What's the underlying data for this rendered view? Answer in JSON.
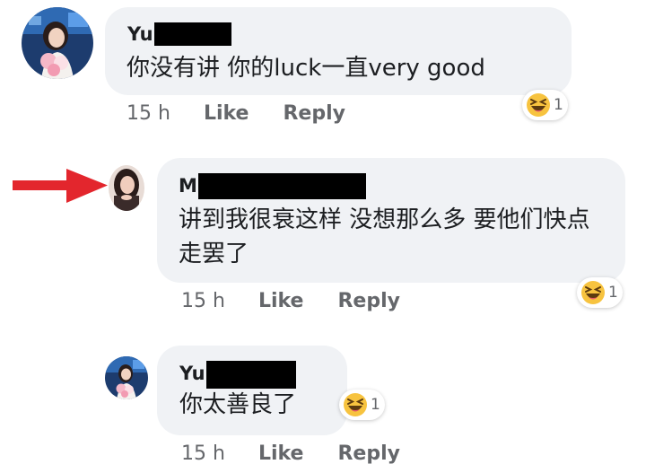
{
  "comments": [
    {
      "author_prefix": "Yu",
      "text": "你没有讲 你的luck一直very good",
      "time": "15 h",
      "like_label": "Like",
      "reply_label": "Reply",
      "reaction_icon": "laughing-emoji-icon",
      "reaction_count": "1"
    },
    {
      "author_prefix": "M",
      "text": "讲到我很衰这样 没想那么多 要他们快点走罢了",
      "time": "15 h",
      "like_label": "Like",
      "reply_label": "Reply",
      "reaction_icon": "laughing-emoji-icon",
      "reaction_count": "1"
    },
    {
      "author_prefix": "Yu",
      "text": "你太善良了",
      "time": "15 h",
      "like_label": "Like",
      "reply_label": "Reply",
      "reaction_icon": "laughing-emoji-icon",
      "reaction_count": "1"
    }
  ],
  "annotation": {
    "arrow_color": "#e3262d"
  },
  "colors": {
    "bubble": "#f0f2f5",
    "meta_text": "#65676b",
    "emoji_face": "#f7c33f"
  }
}
